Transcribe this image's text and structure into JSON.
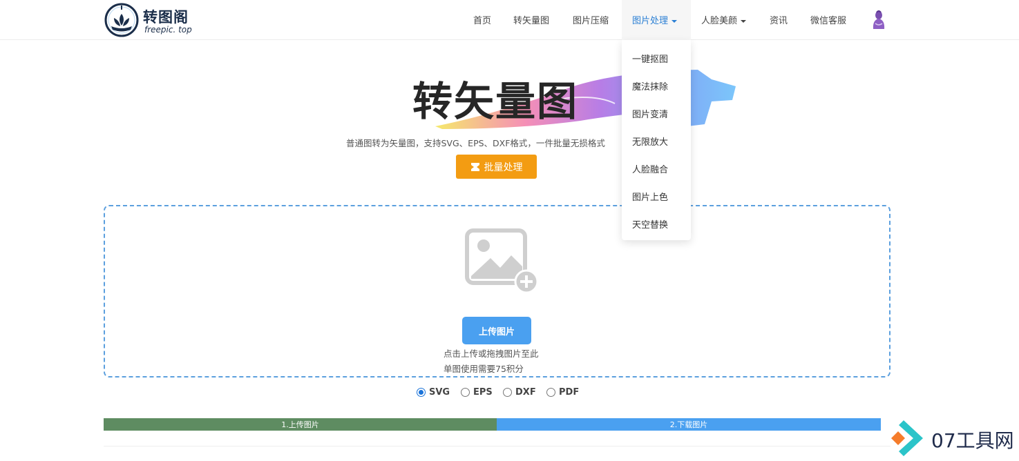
{
  "header": {
    "logo": {
      "name": "转图阁",
      "sub": "freepic. top"
    },
    "nav": [
      {
        "label": "首页"
      },
      {
        "label": "转矢量图"
      },
      {
        "label": "图片压缩"
      },
      {
        "label": "图片处理"
      },
      {
        "label": "人脸美颜"
      },
      {
        "label": "资讯"
      },
      {
        "label": "微信客服"
      }
    ]
  },
  "dropdown": {
    "items": [
      "一键抠图",
      "魔法抹除",
      "图片变清",
      "无限放大",
      "人脸融合",
      "图片上色",
      "天空替换"
    ]
  },
  "hero": {
    "title": "转矢量图",
    "subtitle": "普通图转为矢量图，支持SVG、EPS、DXF格式，一件批量无损格式",
    "batch_label": "批量处理"
  },
  "upload": {
    "button_label": "上传图片",
    "hint_line1": "点击上传或拖拽图片至此",
    "hint_line2": "单图使用需要75积分"
  },
  "formats": {
    "selected": "SVG",
    "options": [
      "SVG",
      "EPS",
      "DXF",
      "PDF"
    ]
  },
  "steps": [
    "1.上传图片",
    "2.下载图片"
  ],
  "watermark": {
    "text": "07工具网"
  },
  "colors": {
    "accent": "#2a7fd4",
    "batch": "#f39c12",
    "upload": "#4aa0f0",
    "step1": "#5e8c61",
    "step2": "#4aa0f0"
  }
}
